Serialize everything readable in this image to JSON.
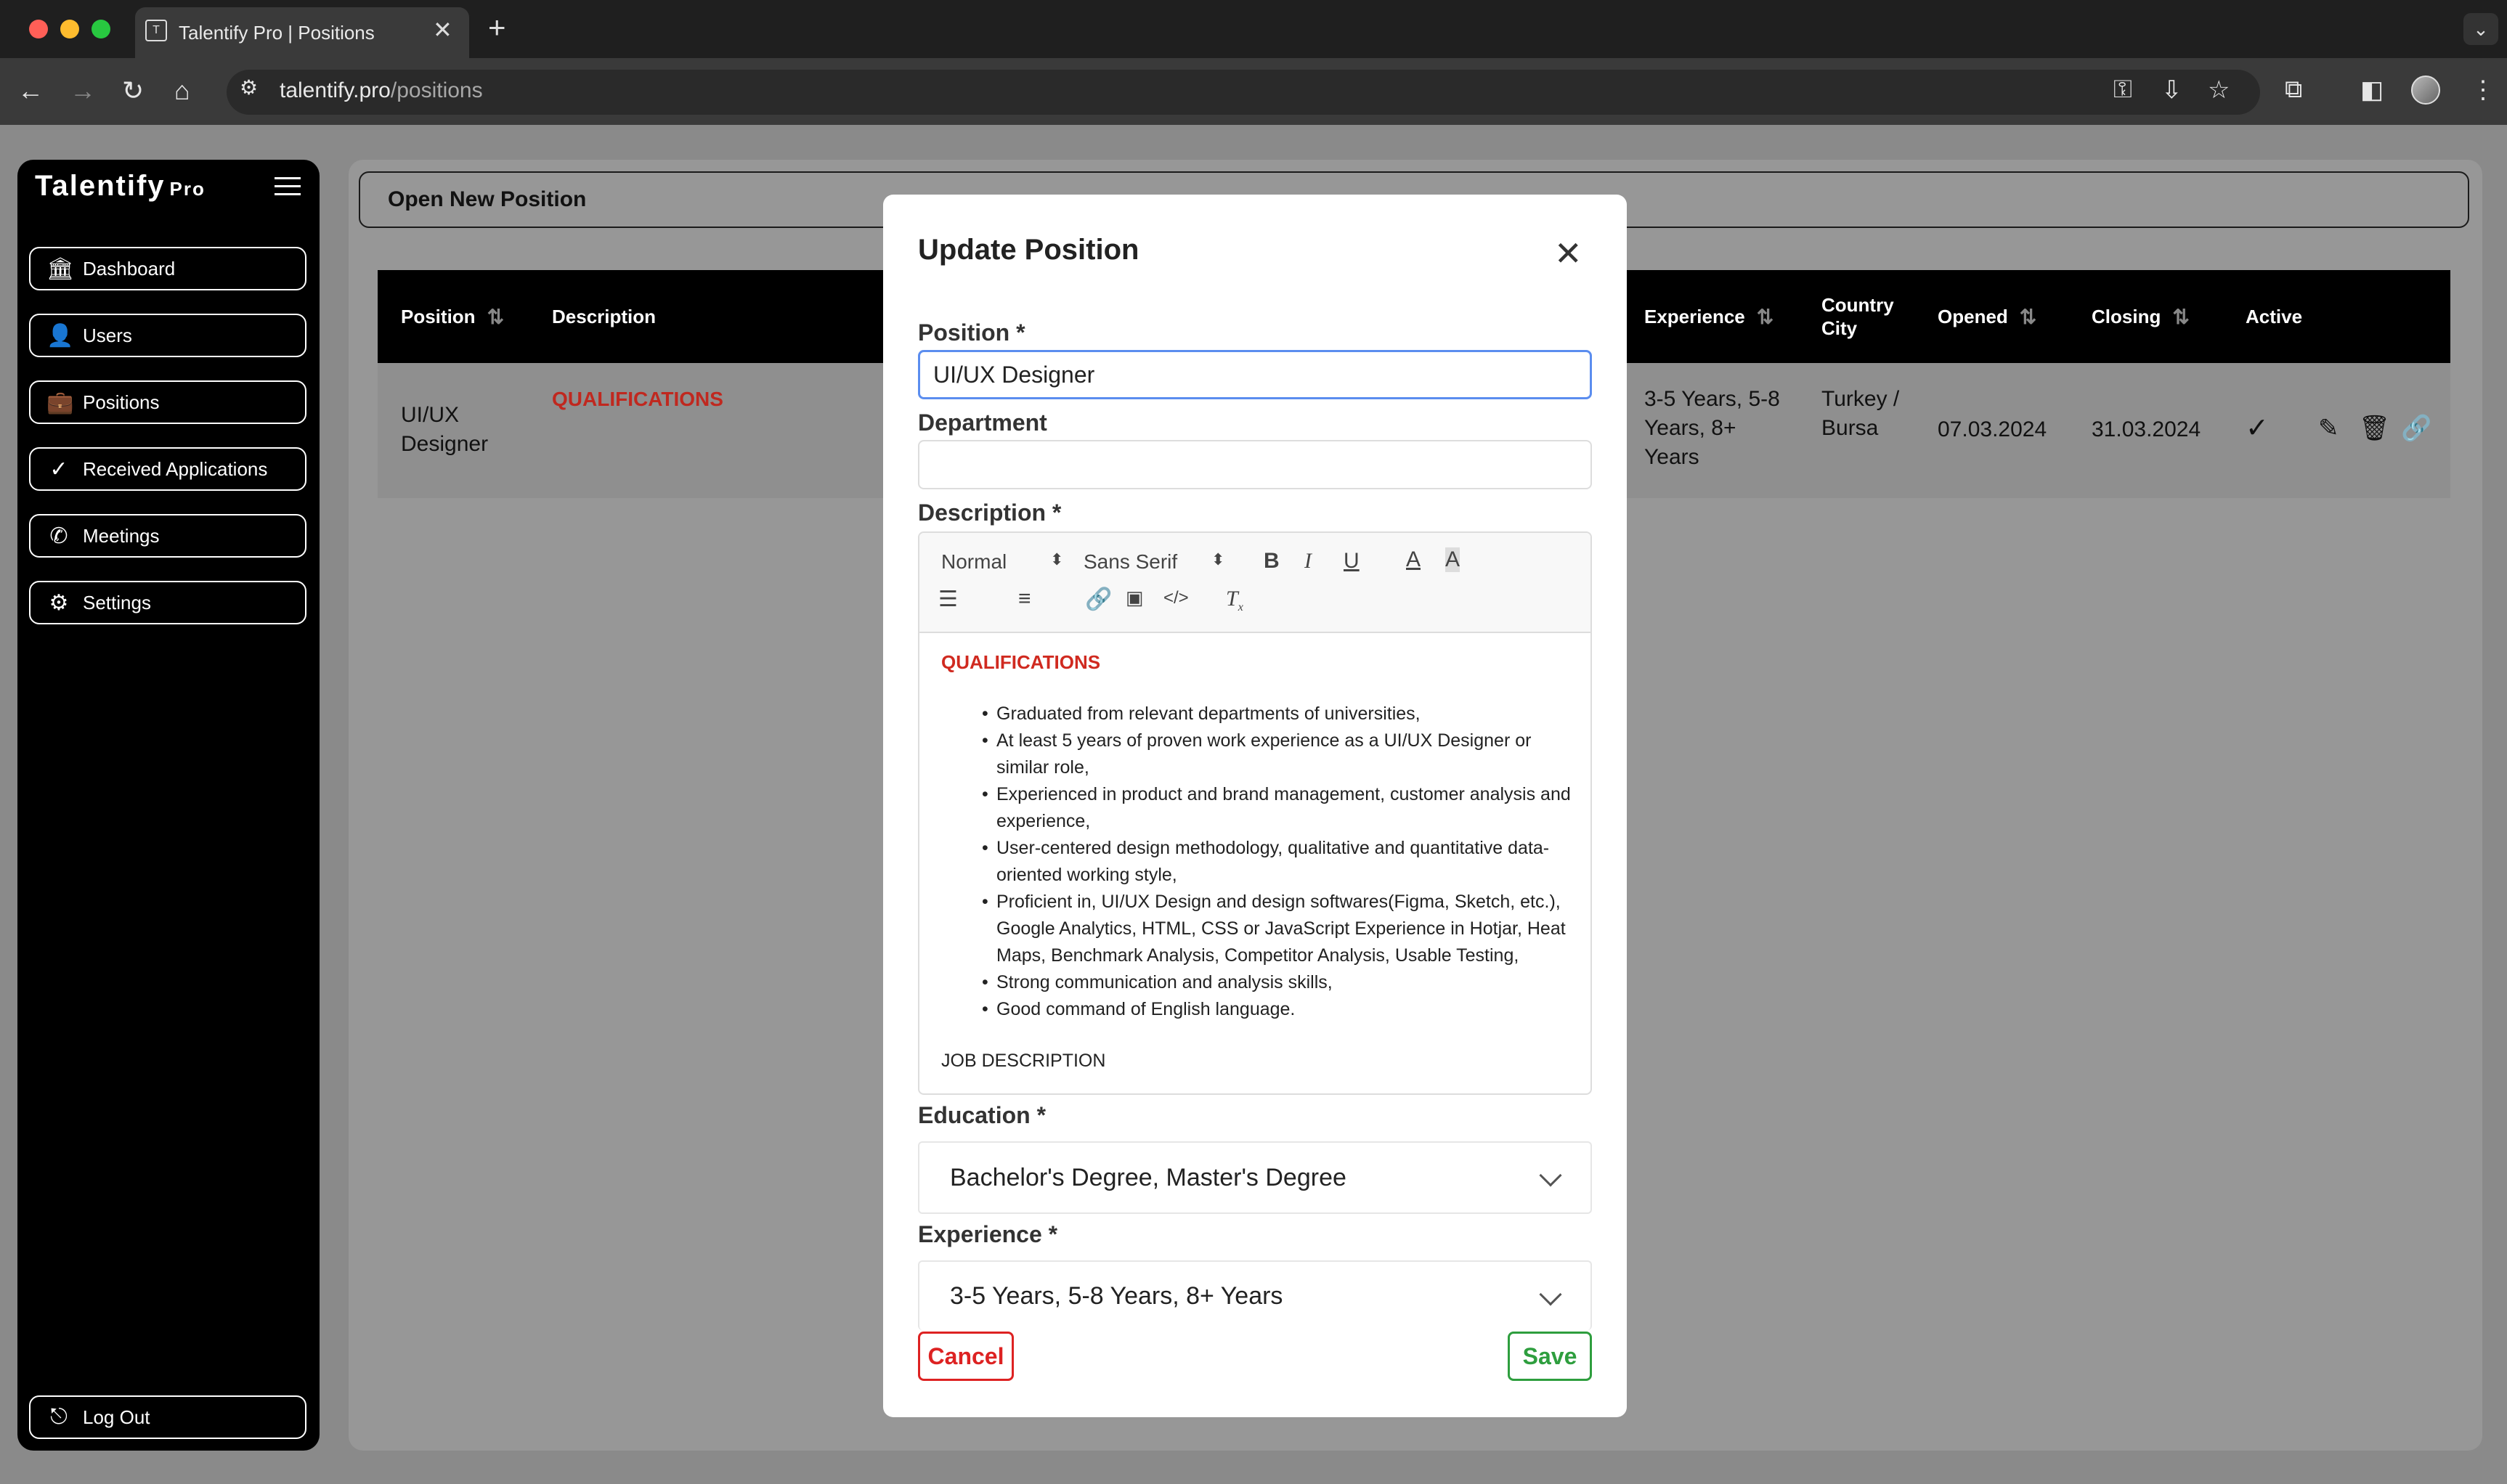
{
  "browser": {
    "tab_title": "Talentify Pro | Positions",
    "url_domain": "talentify.pro",
    "url_path": "/positions"
  },
  "sidebar": {
    "brand": "Talentify",
    "brand_suffix": "Pro",
    "items": [
      {
        "label": "Dashboard",
        "icon": "bank-icon"
      },
      {
        "label": "Users",
        "icon": "user-icon"
      },
      {
        "label": "Positions",
        "icon": "briefcase-icon"
      },
      {
        "label": "Received Applications",
        "icon": "check-icon"
      },
      {
        "label": "Meetings",
        "icon": "phone-icon"
      },
      {
        "label": "Settings",
        "icon": "gear-icon"
      }
    ],
    "logout": "Log Out"
  },
  "main": {
    "open_button": "Open New Position",
    "table": {
      "headers": [
        "Position",
        "Description",
        "Experience",
        "Country City",
        "Opened",
        "Closing",
        "Active"
      ],
      "row": {
        "position": "UI/UX Designer",
        "description": "QUALIFICATIONS",
        "experience": "3-5 Years, 5-8 Years, 8+ Years",
        "location": "Turkey / Bursa",
        "opened": "07.03.2024",
        "closing": "31.03.2024",
        "active": "✓"
      }
    }
  },
  "modal": {
    "title": "Update Position",
    "position_label": "Position *",
    "position_value": "UI/UX Designer",
    "department_label": "Department",
    "department_value": "",
    "description_label": "Description *",
    "toolbar": {
      "heading": "Normal",
      "font": "Sans Serif"
    },
    "description": {
      "heading": "QUALIFICATIONS",
      "bullets": [
        "Graduated from relevant departments of universities,",
        "At least 5 years of proven work experience as a UI/UX Designer or similar role,",
        "Experienced in product and brand management, customer analysis and experience,",
        "User-centered design methodology, qualitative and quantitative data-oriented working style,",
        "Proficient in, UI/UX Design and design softwares(Figma, Sketch, etc.), Google Analytics, HTML, CSS or JavaScript Experience in Hotjar, Heat Maps, Benchmark Analysis, Competitor Analysis, Usable Testing,",
        "Strong communication and analysis skills,",
        "Good command of English language."
      ],
      "next_heading": "JOB DESCRIPTION"
    },
    "education_label": "Education *",
    "education_value": "Bachelor's Degree, Master's Degree",
    "experience_label": "Experience *",
    "experience_value": "3-5 Years, 5-8 Years, 8+ Years",
    "cancel": "Cancel",
    "save": "Save"
  },
  "colors": {
    "accent_red": "#d22222",
    "accent_green": "#2e9e3e",
    "focus_blue": "#5b8def"
  }
}
